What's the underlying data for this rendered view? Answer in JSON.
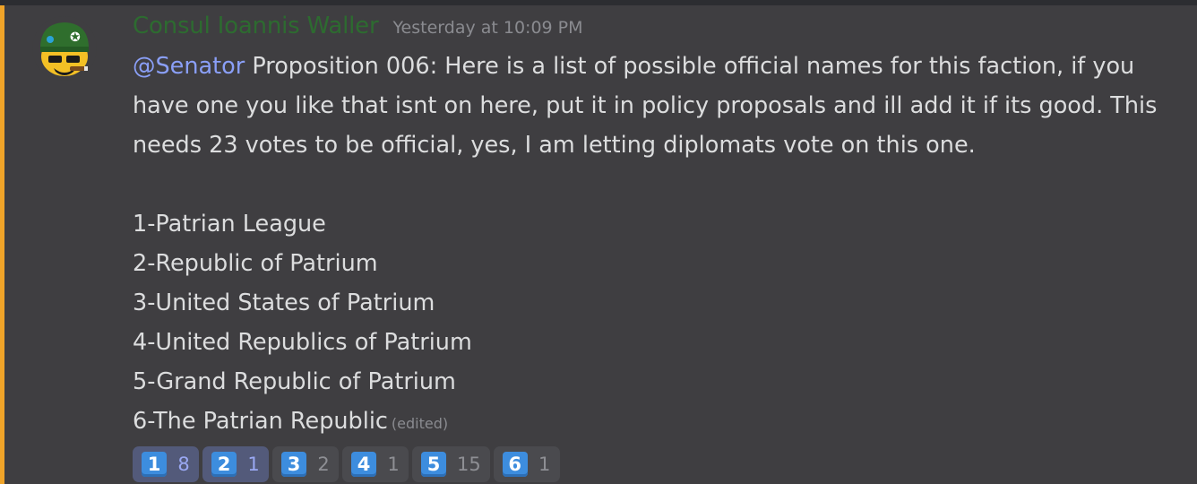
{
  "message": {
    "author": "Consul Ioannis Waller",
    "timestamp": "Yesterday at 10:09 PM",
    "mention": "@Senator",
    "lines": [
      " Proposition 006: Here is a list of possible official names for this faction, if you",
      "have one you like that isnt on here, put it in policy proposals and ill add it if its good. This",
      "needs 23 votes to be official, yes, I am letting diplomats vote on this one."
    ],
    "options": [
      "1-Patrian League",
      "2-Republic of Patrium",
      "3-United States of Patrium",
      "4-United Republics of Patrium",
      "5-Grand Republic of Patrium",
      "6-The Patrian Republic"
    ],
    "edited_label": "(edited)"
  },
  "reactions": [
    {
      "emoji": "1",
      "count": "8",
      "me": true
    },
    {
      "emoji": "2",
      "count": "1",
      "me": true
    },
    {
      "emoji": "3",
      "count": "2",
      "me": false
    },
    {
      "emoji": "4",
      "count": "1",
      "me": false
    },
    {
      "emoji": "5",
      "count": "15",
      "me": false
    },
    {
      "emoji": "6",
      "count": "1",
      "me": false
    }
  ],
  "colors": {
    "background": "#3f3e41",
    "mention_bar": "#f0a429",
    "author": "#2d6b30",
    "mention": "#8a9ff7",
    "keycap": "#3d8dde"
  },
  "avatar_icon": "soldier-emoji-avatar"
}
